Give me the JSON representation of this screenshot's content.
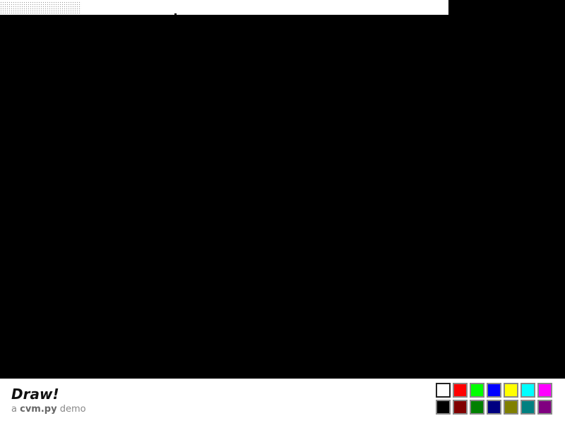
{
  "app": {
    "title": "Draw!",
    "subtitle_prefix": "a ",
    "subtitle_name": "cvm.py",
    "subtitle_suffix": " demo"
  },
  "canvas": {
    "background": "#000000"
  },
  "palette": {
    "selected_index": 0,
    "colors": [
      "#ffffff",
      "#ff0000",
      "#00ff00",
      "#0000ff",
      "#ffff00",
      "#00ffff",
      "#ff00ff",
      "#000000",
      "#800000",
      "#008000",
      "#000080",
      "#808000",
      "#008080",
      "#800080"
    ]
  }
}
